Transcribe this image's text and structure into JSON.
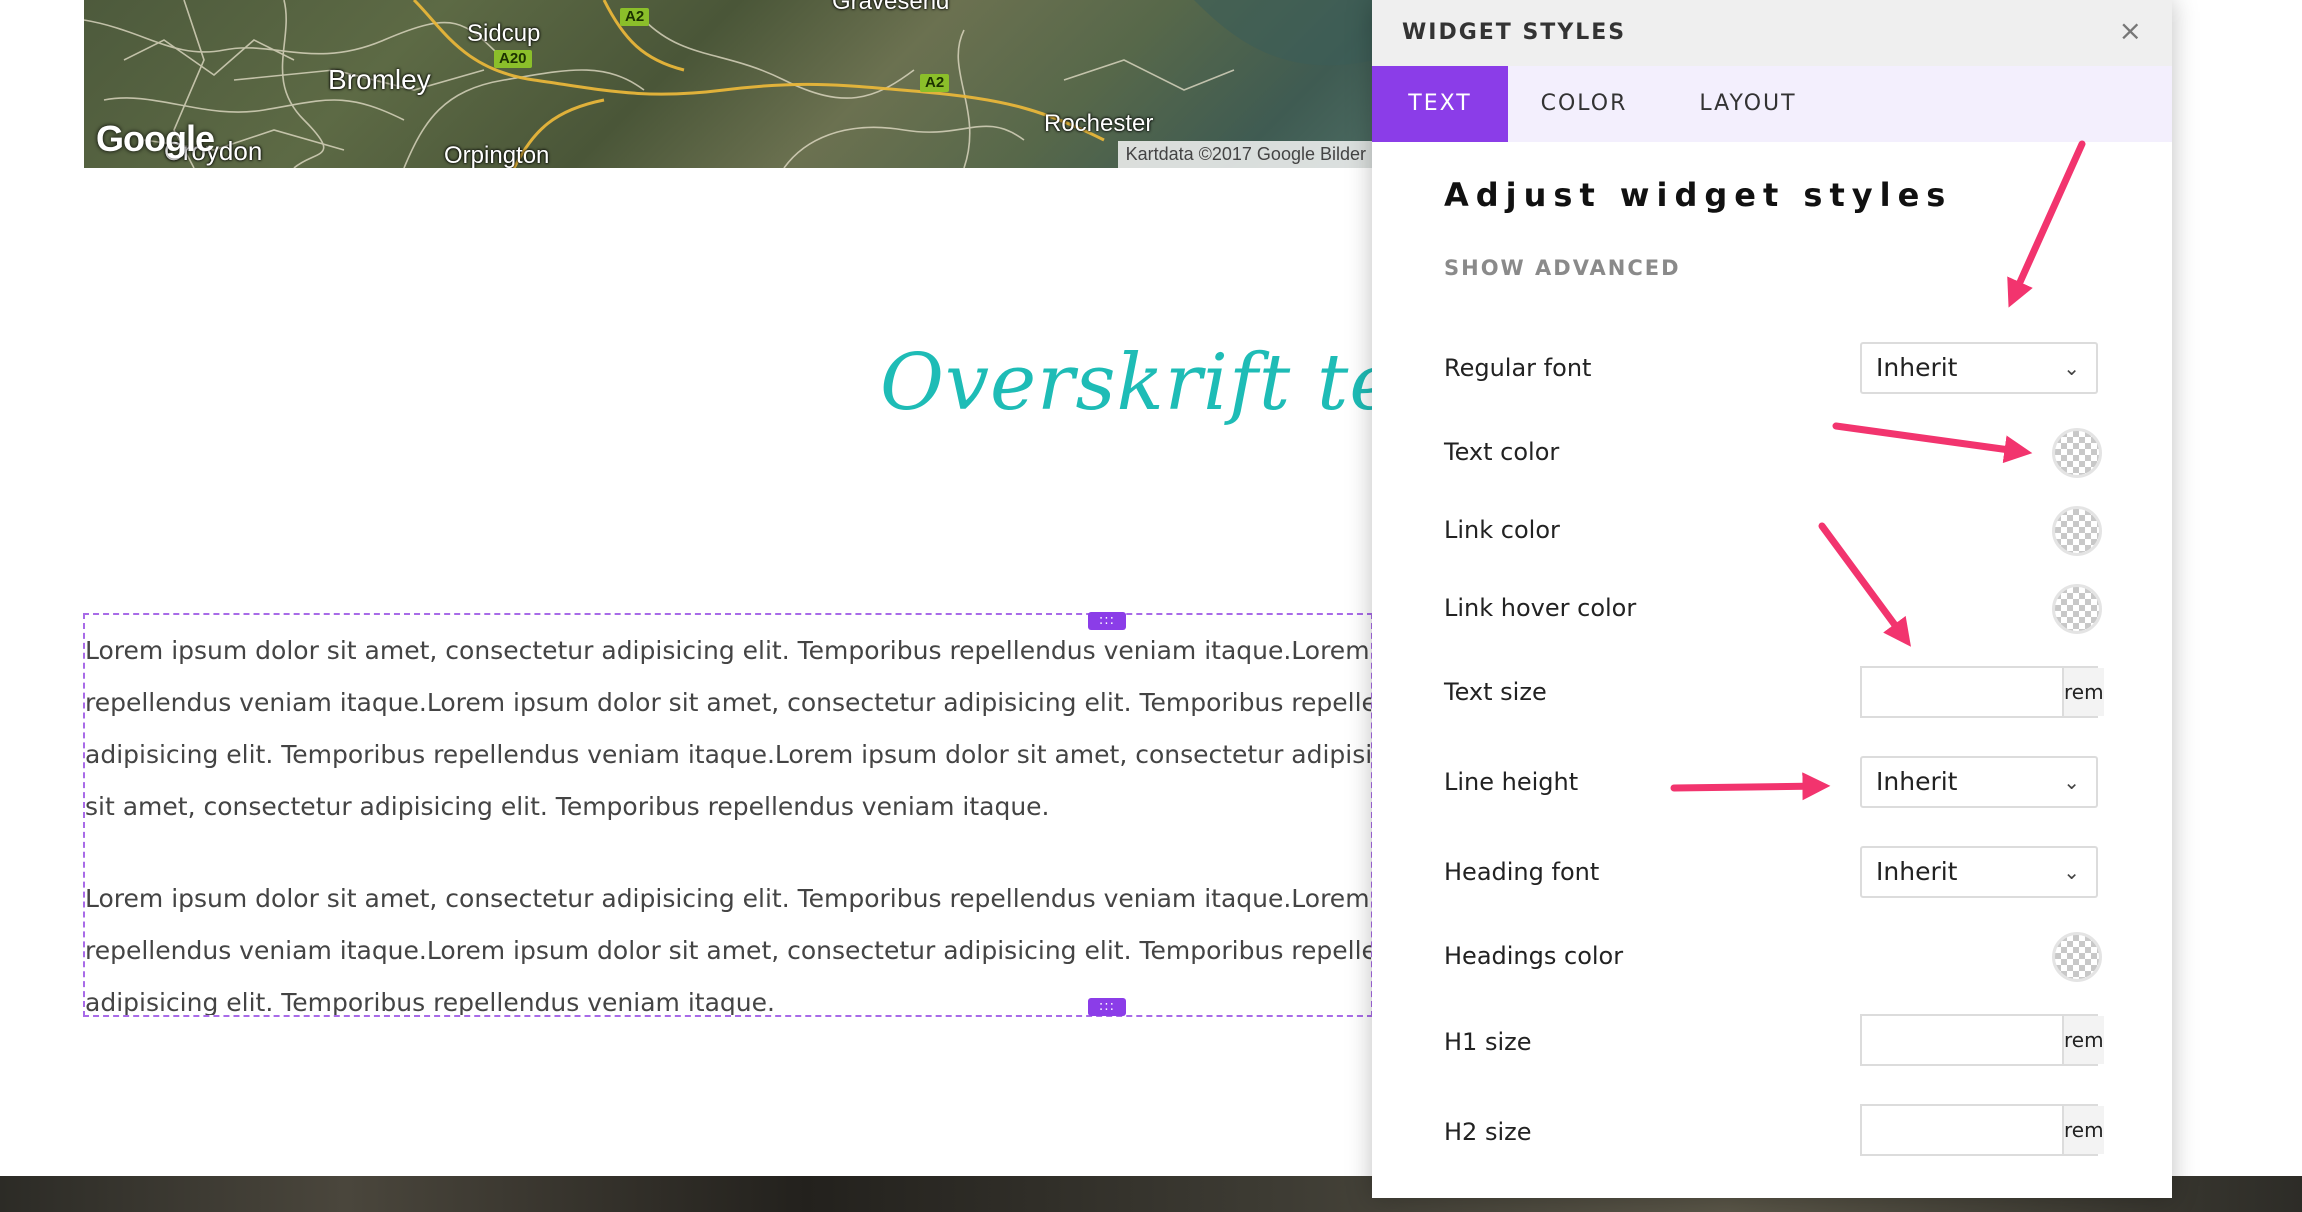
{
  "map": {
    "places": [
      "Sidcup",
      "Bromley",
      "Croydon",
      "Orpington",
      "Rochester",
      "Gravesend"
    ],
    "roads": [
      "A2",
      "A20",
      "A2"
    ],
    "logo": "Google",
    "attribution": "Kartdata ©2017 Google Bilder"
  },
  "page": {
    "heading": "Overskrift test",
    "paragraphs": [
      [
        "Lorem ipsum dolor sit amet, consectetur adipisicing elit. Temporibus repellendus veniam itaque.Lorem ipsum",
        "repellendus veniam itaque.Lorem ipsum dolor sit amet, consectetur adipisicing elit. Temporibus repellendus",
        "adipisicing elit. Temporibus repellendus veniam itaque.Lorem ipsum dolor sit amet, consectetur adipisicing e",
        "sit amet, consectetur adipisicing elit. Temporibus repellendus veniam itaque."
      ],
      [
        "Lorem ipsum dolor sit amet, consectetur adipisicing elit. Temporibus repellendus veniam itaque.Lorem ipsum",
        "repellendus veniam itaque.Lorem ipsum dolor sit amet, consectetur adipisicing elit. Temporibus repellendus",
        "adipisicing elit. Temporibus repellendus veniam itaque."
      ]
    ],
    "handle_glyph": ":::"
  },
  "panel": {
    "title": "WIDGET STYLES",
    "close": "×",
    "tabs": [
      "TEXT",
      "COLOR",
      "LAYOUT"
    ],
    "active_tab": "TEXT",
    "heading": "Adjust widget styles",
    "show_advanced": "SHOW ADVANCED",
    "rows": {
      "regular_font": {
        "label": "Regular font",
        "value": "Inherit"
      },
      "text_color": {
        "label": "Text color"
      },
      "link_color": {
        "label": "Link color"
      },
      "link_hover_color": {
        "label": "Link hover color"
      },
      "text_size": {
        "label": "Text size",
        "unit": "rem"
      },
      "line_height": {
        "label": "Line height",
        "value": "Inherit"
      },
      "heading_font": {
        "label": "Heading font",
        "value": "Inherit"
      },
      "headings_color": {
        "label": "Headings color"
      },
      "h1_size": {
        "label": "H1 size",
        "unit": "rem"
      },
      "h2_size": {
        "label": "H2 size",
        "unit": "rem"
      }
    },
    "chevron": "⌄"
  },
  "colors": {
    "accent": "#8b3de8",
    "heading": "#1ebcb6",
    "arrow": "#f2346e"
  },
  "icons": {
    "close": "close-icon",
    "chevron": "chevron-down-icon",
    "swatch": "transparent-swatch-icon",
    "handle": "drag-handle-icon"
  }
}
